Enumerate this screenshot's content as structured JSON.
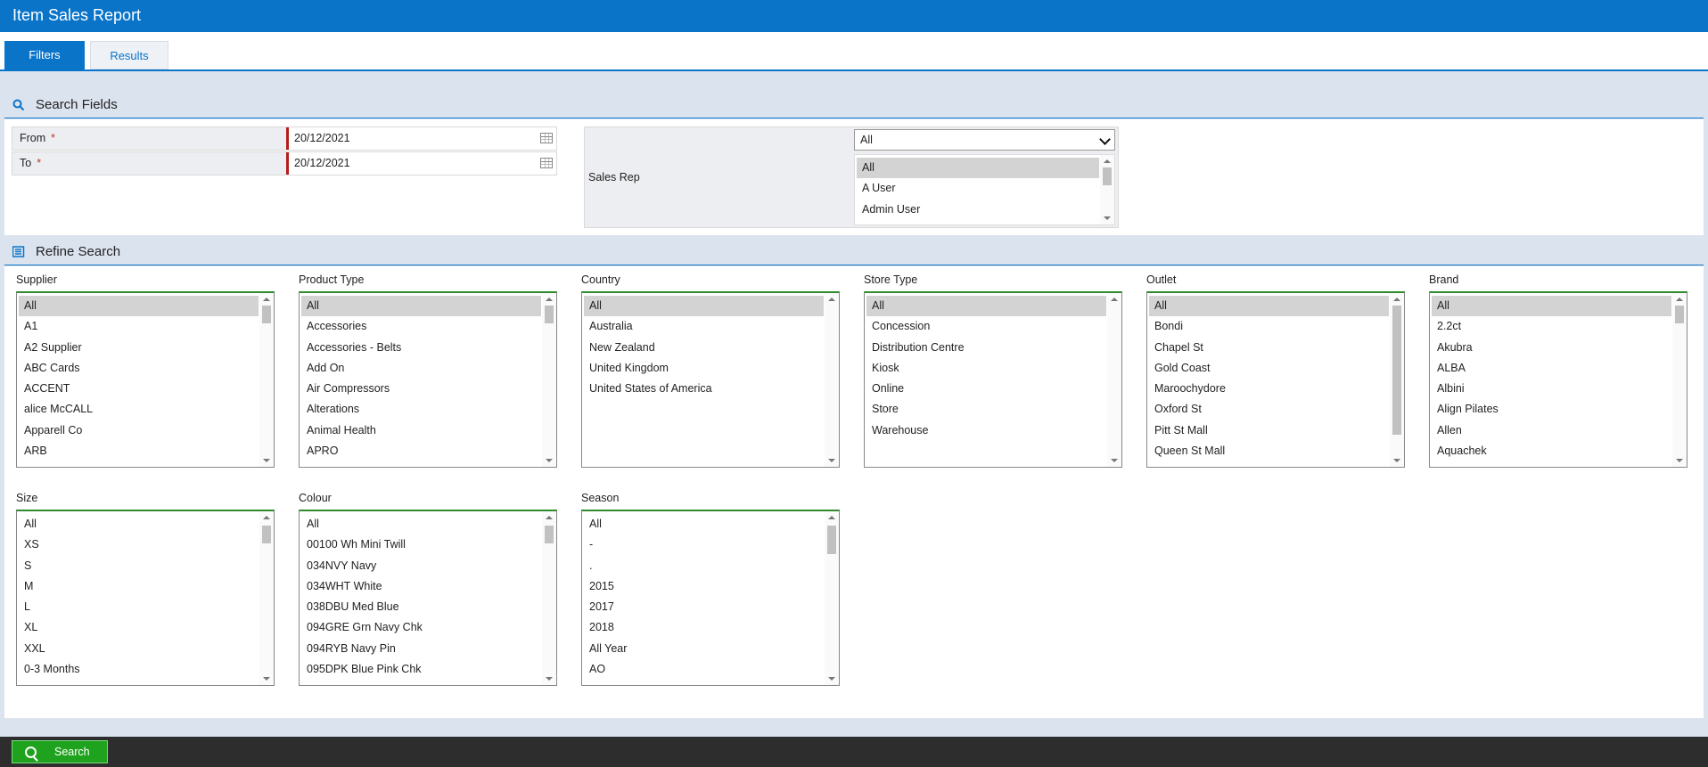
{
  "app": {
    "title": "Item Sales Report"
  },
  "tabs": [
    {
      "label": "Filters"
    },
    {
      "label": "Results"
    }
  ],
  "search_fields": {
    "title": "Search Fields",
    "from": {
      "label": "From",
      "value": "20/12/2021"
    },
    "to": {
      "label": "To",
      "value": "20/12/2021"
    },
    "required_mark": "*",
    "sales_rep": {
      "label": "Sales Rep",
      "selected": "All",
      "options": [
        "All",
        "A User",
        "Admin User"
      ]
    }
  },
  "refine": {
    "title": "Refine Search",
    "groups": [
      {
        "label": "Supplier",
        "items": [
          "All",
          "A1",
          "A2 Supplier",
          "ABC Cards",
          "ACCENT",
          "alice McCALL",
          "Apparell Co",
          "ARB"
        ],
        "selected": 0
      },
      {
        "label": "Product Type",
        "items": [
          "All",
          "Accessories",
          "Accessories - Belts",
          "Add On",
          "Air Compressors",
          "Alterations",
          "Animal Health",
          "APRO"
        ],
        "selected": 0
      },
      {
        "label": "Country",
        "items": [
          "All",
          "Australia",
          "New Zealand",
          "United Kingdom",
          "United States of America"
        ],
        "selected": 0
      },
      {
        "label": "Store Type",
        "items": [
          "All",
          "Concession",
          "Distribution Centre",
          "Kiosk",
          "Online",
          "Store",
          "Warehouse"
        ],
        "selected": 0
      },
      {
        "label": "Outlet",
        "items": [
          "All",
          "Bondi",
          "Chapel St",
          "Gold Coast",
          "Maroochydore",
          "Oxford St",
          "Pitt St Mall",
          "Queen St Mall"
        ],
        "selected": 0
      },
      {
        "label": "Brand",
        "items": [
          "All",
          "2.2ct",
          "Akubra",
          "ALBA",
          "Albini",
          "Align Pilates",
          "Allen",
          "Aquachek"
        ],
        "selected": 0
      },
      {
        "label": "Size",
        "items": [
          "All",
          "XS",
          "S",
          "M",
          "L",
          "XL",
          "XXL",
          "0-3 Months"
        ],
        "selected": -1
      },
      {
        "label": "Colour",
        "items": [
          "All",
          "00100 Wh Mini Twill",
          "034NVY Navy",
          "034WHT White",
          "038DBU Med Blue",
          "094GRE Grn Navy Chk",
          "094RYB Navy Pin",
          "095DPK Blue Pink Chk"
        ],
        "selected": -1
      },
      {
        "label": "Season",
        "items": [
          "All",
          "-",
          ".",
          "2015",
          "2017",
          "2018",
          "All Year",
          "AO"
        ],
        "selected": -1
      }
    ]
  },
  "footer": {
    "search_label": "Search"
  },
  "colors": {
    "accent": "#0a74c9",
    "search_green": "#1fa31f",
    "required": "#b71c1c"
  },
  "icons": {
    "search_section": "search-icon",
    "refine_section": "list-icon"
  }
}
